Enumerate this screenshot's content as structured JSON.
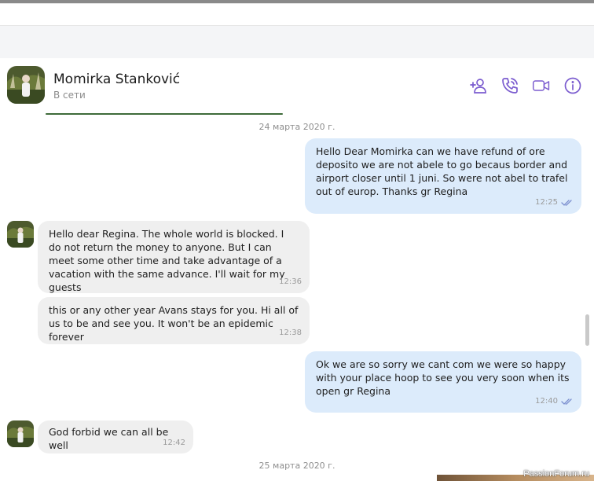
{
  "contact": {
    "name": "Momirka Stanković",
    "status": "В сети"
  },
  "header_icons": [
    "add-contact-icon",
    "voice-call-icon",
    "video-call-icon",
    "info-icon"
  ],
  "colors": {
    "accent": "#7b5ccf",
    "outgoing_bubble": "#dcebfb",
    "incoming_bubble": "#efefef"
  },
  "dates": [
    "24 марта 2020 г.",
    "25 марта 2020 г."
  ],
  "messages": [
    {
      "direction": "out",
      "text": "Hello Dear Momirka can we have refund of ore deposito we are not abele to go becaus border and airport closer until 1 juni. So were not abel to trafel out of europ. Thanks gr Regina",
      "time": "12:25",
      "read": true
    },
    {
      "direction": "in",
      "text": "Hello dear Regina.  The whole world is blocked.  I do not return the money to anyone.  But I can meet some other time and take advantage of a vacation with the same advance.  I'll wait for my guests",
      "time": "12:36"
    },
    {
      "direction": "in",
      "text": "this or any other year Avans stays for you.  Hi all of us to be and see you.  It won't be an epidemic forever",
      "time": "12:38"
    },
    {
      "direction": "out",
      "text": "Ok we are so sorry we cant com we were so happy with your place hoop to see you very soon when its open gr Regina",
      "time": "12:40",
      "read": true
    },
    {
      "direction": "in",
      "text": "God forbid we can all be well",
      "time": "12:42"
    }
  ],
  "watermark": "PassionForum.ru"
}
